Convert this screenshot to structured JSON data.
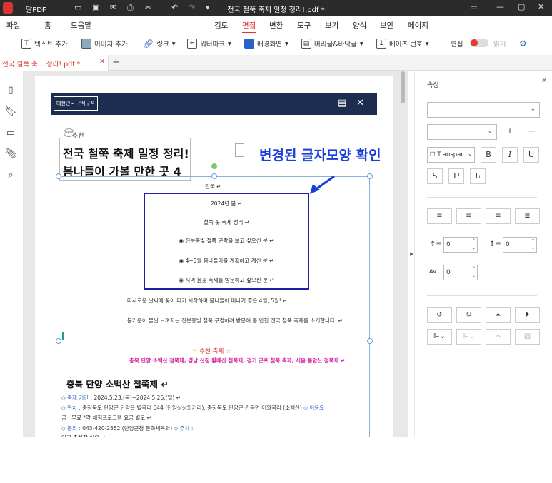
{
  "app": {
    "name": "알PDF",
    "doc_title": "전국 철쭉 축제 일정 정리!.pdf *"
  },
  "menu": [
    "파일",
    "홈",
    "도움말",
    "검토",
    "편집",
    "변환",
    "도구",
    "보기",
    "양식",
    "보안",
    "페이지"
  ],
  "menu_active": "편집",
  "toolbar": {
    "add_text": "텍스트 추가",
    "add_image": "이미지 추가",
    "link": "링크",
    "watermark": "워터마크",
    "background": "배경화면",
    "header_footer": "머리글&바닥글",
    "bates": "베이츠 번호",
    "edit": "편집",
    "read": "읽기"
  },
  "tab": {
    "label": "전국 철쭉 축... 정리!.pdf *"
  },
  "doc": {
    "banner_label": "대한민국 구석구석",
    "rec_badge": "New",
    "rec_text": "추천",
    "title_line1": "전국 철쭉 축제 일정 정리!",
    "title_line2": "봄나들이 가볼 만한 곳 4",
    "annotation": "변경된 글자모양 확인",
    "national": "전국 ↵",
    "box_lines": [
      "2024년 봄 ↵",
      "철쭉 꽃 축제 정리 ↵",
      "◉ 진분홍빛 철쭉 군락을 보고 싶으신 분 ↵",
      "◉ 4~5월 봄나들이를 계획하고 계신 분 ↵",
      "◉ 지역 봄꽃 축제를 방문하고 싶으신 분 ↵"
    ],
    "para1": "따사로운 날씨에 꽃이 피기 시작하며 봄나들이 떠나기 좋은 4월, 5월! ↵",
    "para2": "봄기운이 물씬 느껴지는 진분홍빛 철쭉 구경하려 방문해 볼 만한 전국 철쭉 축제를 소개합니다. ↵",
    "star_heading": "추천 축제",
    "pink_line": "충북 단양 소백산 철쭉제, 경남 산청 황매산 철쭉제, 경기 군포 철쭉 축제, 서울 불암산 철쭉제 ↵",
    "section_title": "충북 단양 소백산 철쭉제 ↵",
    "period_label": "◇ 축제 기간 :",
    "period_value": "2024.5.23.(목)~2024.5.26.(일) ↵",
    "location_label": "◇ 위치 :",
    "location_value": "충청북도 단양군 단양읍 별곡리 644 (단양상상의거리), 충청북도 단양군 가곡면 어의곡리 (소백산)",
    "usage_label": "◇ 이용요",
    "usage_value": "금 : 무료 *각 체험프로그램 요금 별도 ↵",
    "contact_label": "◇ 문의 :",
    "contact_value": "043-420-2552 (단양군청 문화체육과)",
    "parking_label": "◇ 주차 :",
    "last_line": "인근 주차장 이용 ↵"
  },
  "panel": {
    "title": "속성",
    "fill_value": "Transpar",
    "spacing_value_1": "0",
    "spacing_value_2": "0",
    "spacing_value_3": "0"
  },
  "colors": {
    "accent": "#d93434",
    "banner": "#1c2d4f",
    "annotation": "#1a3fd6",
    "box_border": "#1f1fa6",
    "pink": "#d4209a"
  }
}
